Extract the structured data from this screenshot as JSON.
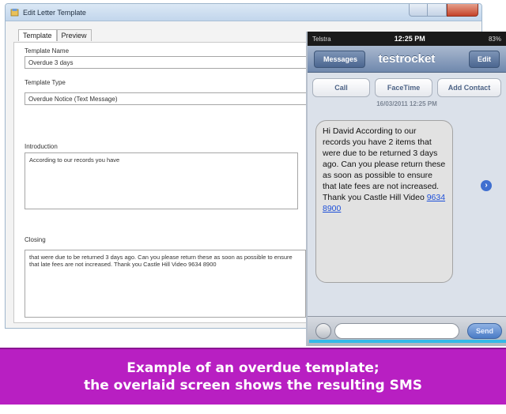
{
  "window": {
    "title": "Edit Letter Template",
    "tabs": [
      "Template",
      "Preview"
    ]
  },
  "form": {
    "template_name_label": "Template Name",
    "template_name_value": "Overdue 3 days",
    "template_type_label": "Template Type",
    "template_type_value": "Overdue Notice (Text Message)",
    "introduction_label": "Introduction",
    "introduction_value": "According to our records you have",
    "closing_label": "Closing",
    "closing_value": "that were due to be returned 3 days ago. Can you please return these as soon as possible to ensure that late fees are not increased. Thank you Castle Hill Video  9634 8900"
  },
  "phone": {
    "carrier": "Telstra",
    "time": "12:25 PM",
    "battery": "83%",
    "back_label": "Messages",
    "title": "testrocket",
    "edit_label": "Edit",
    "actions": [
      "Call",
      "FaceTime",
      "Add Contact"
    ],
    "timestamp": "16/03/2011 12:25 PM",
    "message_text": "Hi David According to our records you have 2 items that were due to be returned 3 days ago. Can you please return these as soon as possible to ensure that late fees are not increased. Thank you Castle Hill Video ",
    "message_link": "9634 8900",
    "send_label": "Send"
  },
  "caption": {
    "line1": "Example of an overdue template;",
    "line2": "the overlaid screen shows the resulting SMS"
  }
}
